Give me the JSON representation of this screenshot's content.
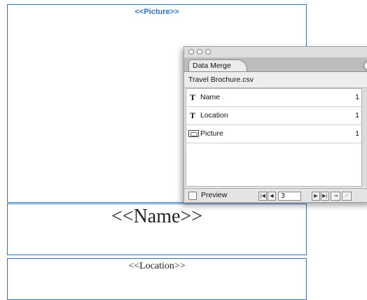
{
  "document": {
    "picture_placeholder": "<<Picture>>",
    "name_placeholder": "<<Name>>",
    "location_placeholder": "<<Location>>"
  },
  "panel": {
    "tab_title": "Data Merge",
    "data_source": "Travel Brochure.csv",
    "fields": [
      {
        "icon": "text-field-icon",
        "type_glyph": "T",
        "label": "Name",
        "count": "1"
      },
      {
        "icon": "text-field-icon",
        "type_glyph": "T",
        "label": "Location",
        "count": "1"
      },
      {
        "icon": "image-field-icon",
        "type_glyph": "",
        "label": "Picture",
        "count": "1"
      }
    ],
    "preview_label": "Preview",
    "record_number": "3"
  },
  "colors": {
    "frame": "#2f75c8"
  }
}
